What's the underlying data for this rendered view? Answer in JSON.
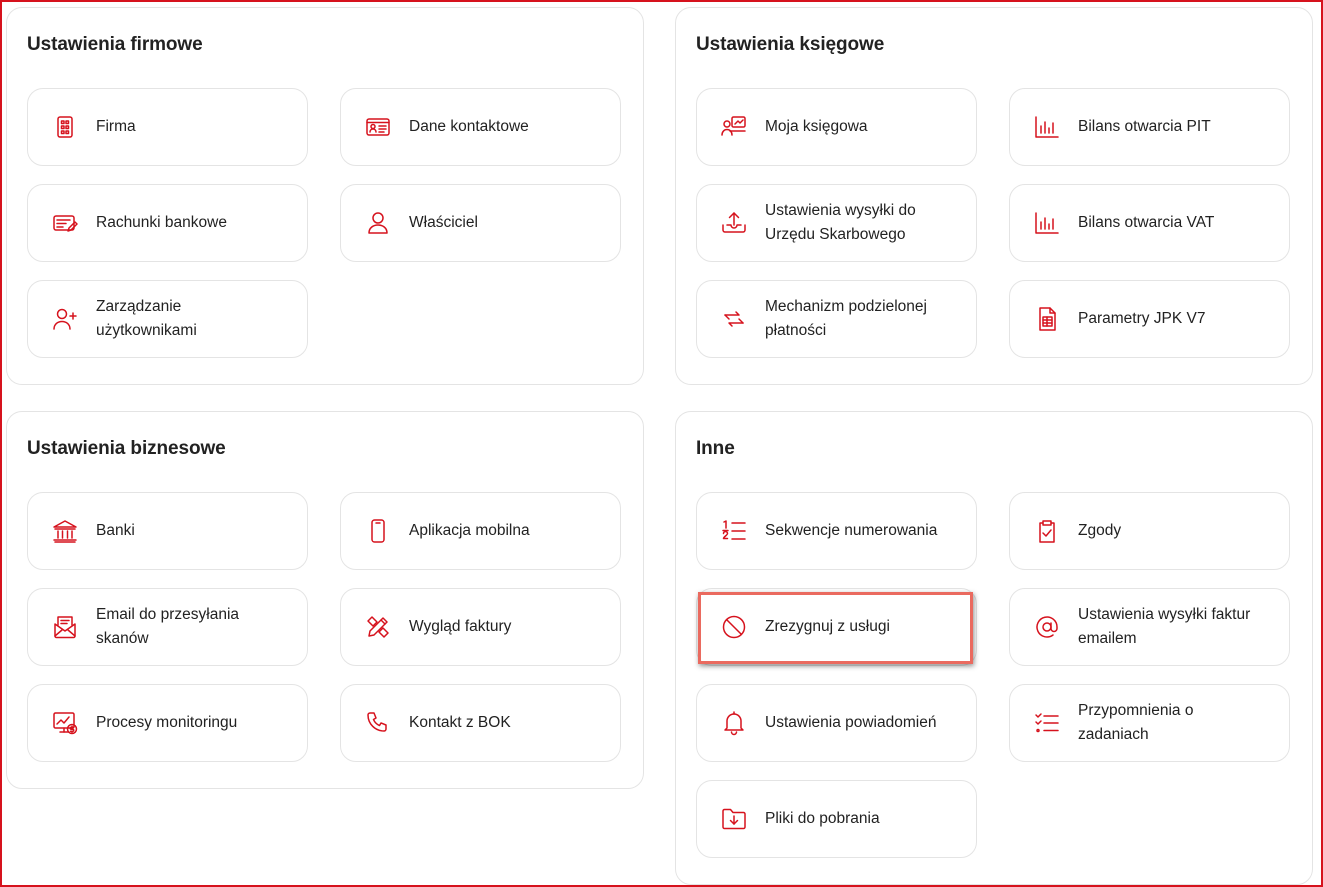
{
  "sections": {
    "firmowe": {
      "title": "Ustawienia firmowe",
      "items": [
        "Firma",
        "Dane kontaktowe",
        "Rachunki bankowe",
        "Właściciel",
        "Zarządzanie użytkownikami"
      ]
    },
    "ksiegowe": {
      "title": "Ustawienia księgowe",
      "items": [
        "Moja księgowa",
        "Bilans otwarcia PIT",
        "Ustawienia wysyłki do Urzędu Skarbowego",
        "Bilans otwarcia VAT",
        "Mechanizm podzielonej płatności",
        "Parametry JPK V7"
      ]
    },
    "biznesowe": {
      "title": "Ustawienia biznesowe",
      "items": [
        "Banki",
        "Aplikacja mobilna",
        "Email do przesyłania skanów",
        "Wygląd faktury",
        "Procesy monitoringu",
        "Kontakt z BOK"
      ]
    },
    "inne": {
      "title": "Inne",
      "items": [
        "Sekwencje numerowania",
        "Zgody",
        "Zrezygnuj z usługi",
        "Ustawienia wysyłki faktur emailem",
        "Ustawienia powiadomień",
        "Przypomnienia o zadaniach",
        "Pliki do pobrania"
      ]
    }
  },
  "icons": {
    "firma": "building-icon",
    "dane_kontaktowe": "contact-card-icon",
    "rachunki": "bank-account-icon",
    "wlasciciel": "user-icon",
    "uzytkownicy": "add-user-icon",
    "ksiegowa": "accountant-icon",
    "bilans_pit": "bar-chart-icon",
    "wysylka_us": "upload-icon",
    "bilans_vat": "bar-chart-icon",
    "split_payment": "exchange-arrows-icon",
    "jpk": "spreadsheet-document-icon",
    "banki": "bank-building-icon",
    "aplikacja": "smartphone-icon",
    "email_skany": "email-inbox-icon",
    "wyglad": "design-tools-icon",
    "monitoring": "monitor-chart-icon",
    "bok": "phone-icon",
    "sekwencje": "numbered-list-icon",
    "zgody": "clipboard-check-icon",
    "rezygnacja": "cancel-circle-icon",
    "email_faktury": "at-sign-icon",
    "powiadomienia": "bell-icon",
    "przypomnienia": "checklist-icon",
    "pliki": "folder-download-icon"
  },
  "colors": {
    "accent": "#d6121d",
    "highlight_border": "#ea6a5f",
    "tile_border": "#e4e4e4"
  }
}
